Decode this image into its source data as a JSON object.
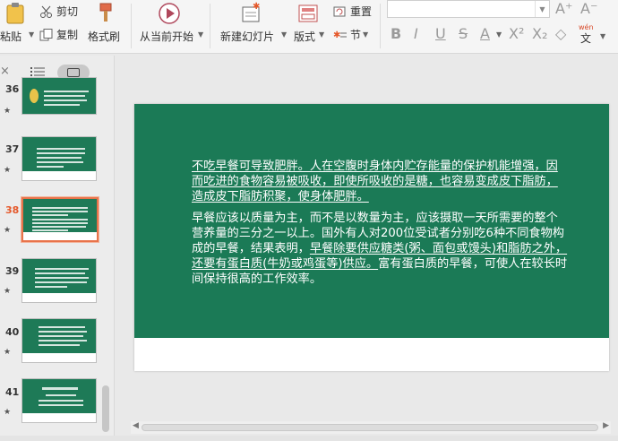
{
  "ribbon": {
    "paste_label": "粘贴",
    "cut_label": "剪切",
    "copy_label": "复制",
    "format_painter_label": "格式刷",
    "play_from_current_label": "从当前开始",
    "new_slide_label": "新建幻灯片",
    "layout_label": "版式",
    "reset_label": "重置",
    "section_label": "节",
    "font_name_value": "",
    "wen_label": "wén",
    "wen_char": "文"
  },
  "panel": {
    "close_label": "×",
    "slides": [
      {
        "number": "36",
        "star": "★"
      },
      {
        "number": "37",
        "star": "★"
      },
      {
        "number": "38",
        "star": "★"
      },
      {
        "number": "39",
        "star": "★"
      },
      {
        "number": "40",
        "star": "★"
      },
      {
        "number": "41",
        "star": "★"
      }
    ]
  },
  "slide": {
    "p1": "不吃早餐可导致肥胖。人在空腹时身体内贮存能量的保护机能增强，因而吃进的食物容易被吸收，即使所吸收的是糖，也容易变成皮下脂肪，造成皮下脂肪积聚，使身体肥胖。",
    "p2_a": "早餐应该以质量为主，而不是以数量为主，应该摄取一天所需要的整个营养量的三分之一以上。国外有人对200位受试者分别吃6种不同食物构成的早餐，结果表明，",
    "p2_b": "早餐除要供应糖类(粥、面包或馒头)和脂肪之外，还要有蛋白质(牛奶或鸡蛋等)供应。",
    "p2_c": "富有蛋白质的早餐，可使人在较长时间保持很高的工作效率。"
  },
  "colors": {
    "slide_green": "#1b7a56",
    "active_thumb_border": "#e8734a",
    "active_number": "#e5582a"
  }
}
